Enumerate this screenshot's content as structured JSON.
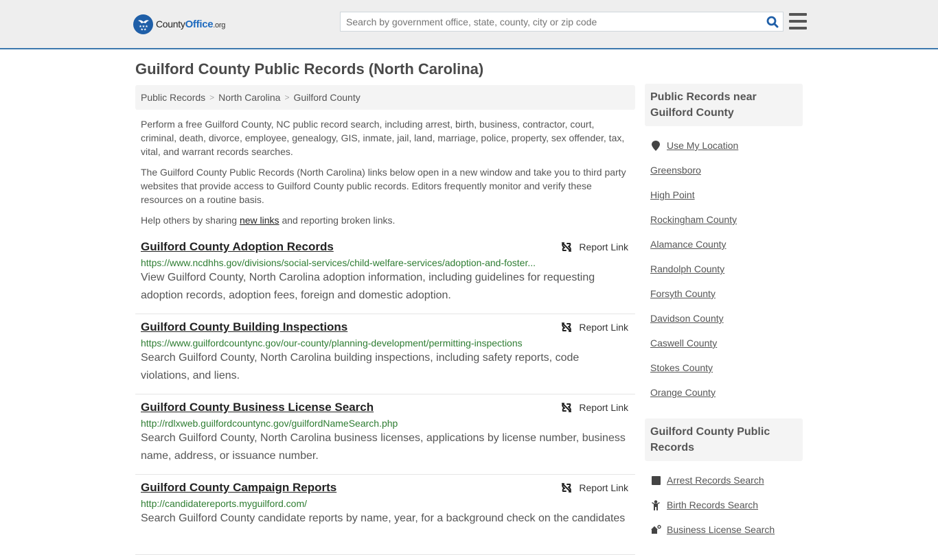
{
  "header": {
    "logo": {
      "county": "County",
      "office": "Office",
      "org": ".org"
    },
    "search_placeholder": "Search by government office, state, county, city or zip code",
    "colors": {
      "brand_blue": "#1f5fa8",
      "accent_border": "#3b78ad",
      "url_green": "#2e7d32"
    }
  },
  "page": {
    "title": "Guilford County Public Records (North Carolina)",
    "breadcrumb": [
      "Public Records",
      "North Carolina",
      "Guilford County"
    ],
    "intro": {
      "p1": "Perform a free Guilford County, NC public record search, including arrest, birth, business, contractor, court, criminal, death, divorce, employee, genealogy, GIS, inmate, jail, land, marriage, police, property, sex offender, tax, vital, and warrant records searches.",
      "p2": "The Guilford County Public Records (North Carolina) links below open in a new window and take you to third party websites that provide access to Guilford County public records. Editors frequently monitor and verify these resources on a routine basis.",
      "p3_before": "Help others by sharing ",
      "p3_link": "new links",
      "p3_after": " and reporting broken links."
    }
  },
  "records": [
    {
      "title": "Guilford County Adoption Records",
      "url": "https://www.ncdhhs.gov/divisions/social-services/child-welfare-services/adoption-and-foster...",
      "description": "View Guilford County, North Carolina adoption information, including guidelines for requesting adoption records, adoption fees, foreign and domestic adoption.",
      "report": "Report Link"
    },
    {
      "title": "Guilford County Building Inspections",
      "url": "https://www.guilfordcountync.gov/our-county/planning-development/permitting-inspections",
      "description": "Search Guilford County, North Carolina building inspections, including safety reports, code violations, and liens.",
      "report": "Report Link"
    },
    {
      "title": "Guilford County Business License Search",
      "url": "http://rdlxweb.guilfordcountync.gov/guilfordNameSearch.php",
      "description": "Search Guilford County, North Carolina business licenses, applications by license number, business name, address, or issuance number.",
      "report": "Report Link"
    },
    {
      "title": "Guilford County Campaign Reports",
      "url": "http://candidatereports.myguilford.com/",
      "description": "Search Guilford County candidate reports by name, year, for a background check on the candidates",
      "report": "Report Link"
    }
  ],
  "sidebar": {
    "nearby_heading": "Public Records near Guilford County",
    "use_location": "Use My Location",
    "nearby": [
      "Greensboro",
      "High Point",
      "Rockingham County",
      "Alamance County",
      "Randolph County",
      "Forsyth County",
      "Davidson County",
      "Caswell County",
      "Stokes County",
      "Orange County"
    ],
    "records_heading": "Guilford County Public Records",
    "record_links": [
      {
        "label": "Arrest Records Search",
        "icon": "arrest-icon"
      },
      {
        "label": "Birth Records Search",
        "icon": "baby-icon"
      },
      {
        "label": "Business License Search",
        "icon": "business-icon"
      }
    ]
  }
}
